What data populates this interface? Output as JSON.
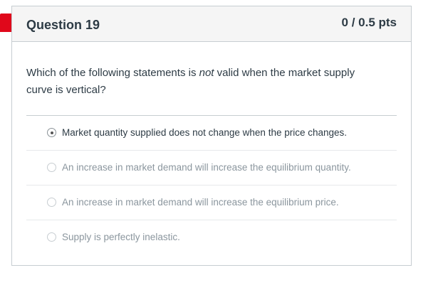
{
  "question": {
    "title": "Question 19",
    "points": "0 / 0.5 pts",
    "text_prefix": "Which of the following statements is ",
    "text_emphasis": "not",
    "text_suffix": " valid when the market supply curve is vertical?"
  },
  "answers": [
    {
      "label": "Market quantity supplied does not change when the price changes.",
      "selected": true
    },
    {
      "label": "An increase in market demand will increase the equilibrium quantity.",
      "selected": false
    },
    {
      "label": "An increase in market demand will increase the equilibrium price.",
      "selected": false
    },
    {
      "label": "Supply is perfectly inelastic.",
      "selected": false
    }
  ],
  "colors": {
    "flag": "#e0081b",
    "text": "#2d3b45",
    "muted_text": "#8b969e",
    "border": "#c7cdd1"
  }
}
